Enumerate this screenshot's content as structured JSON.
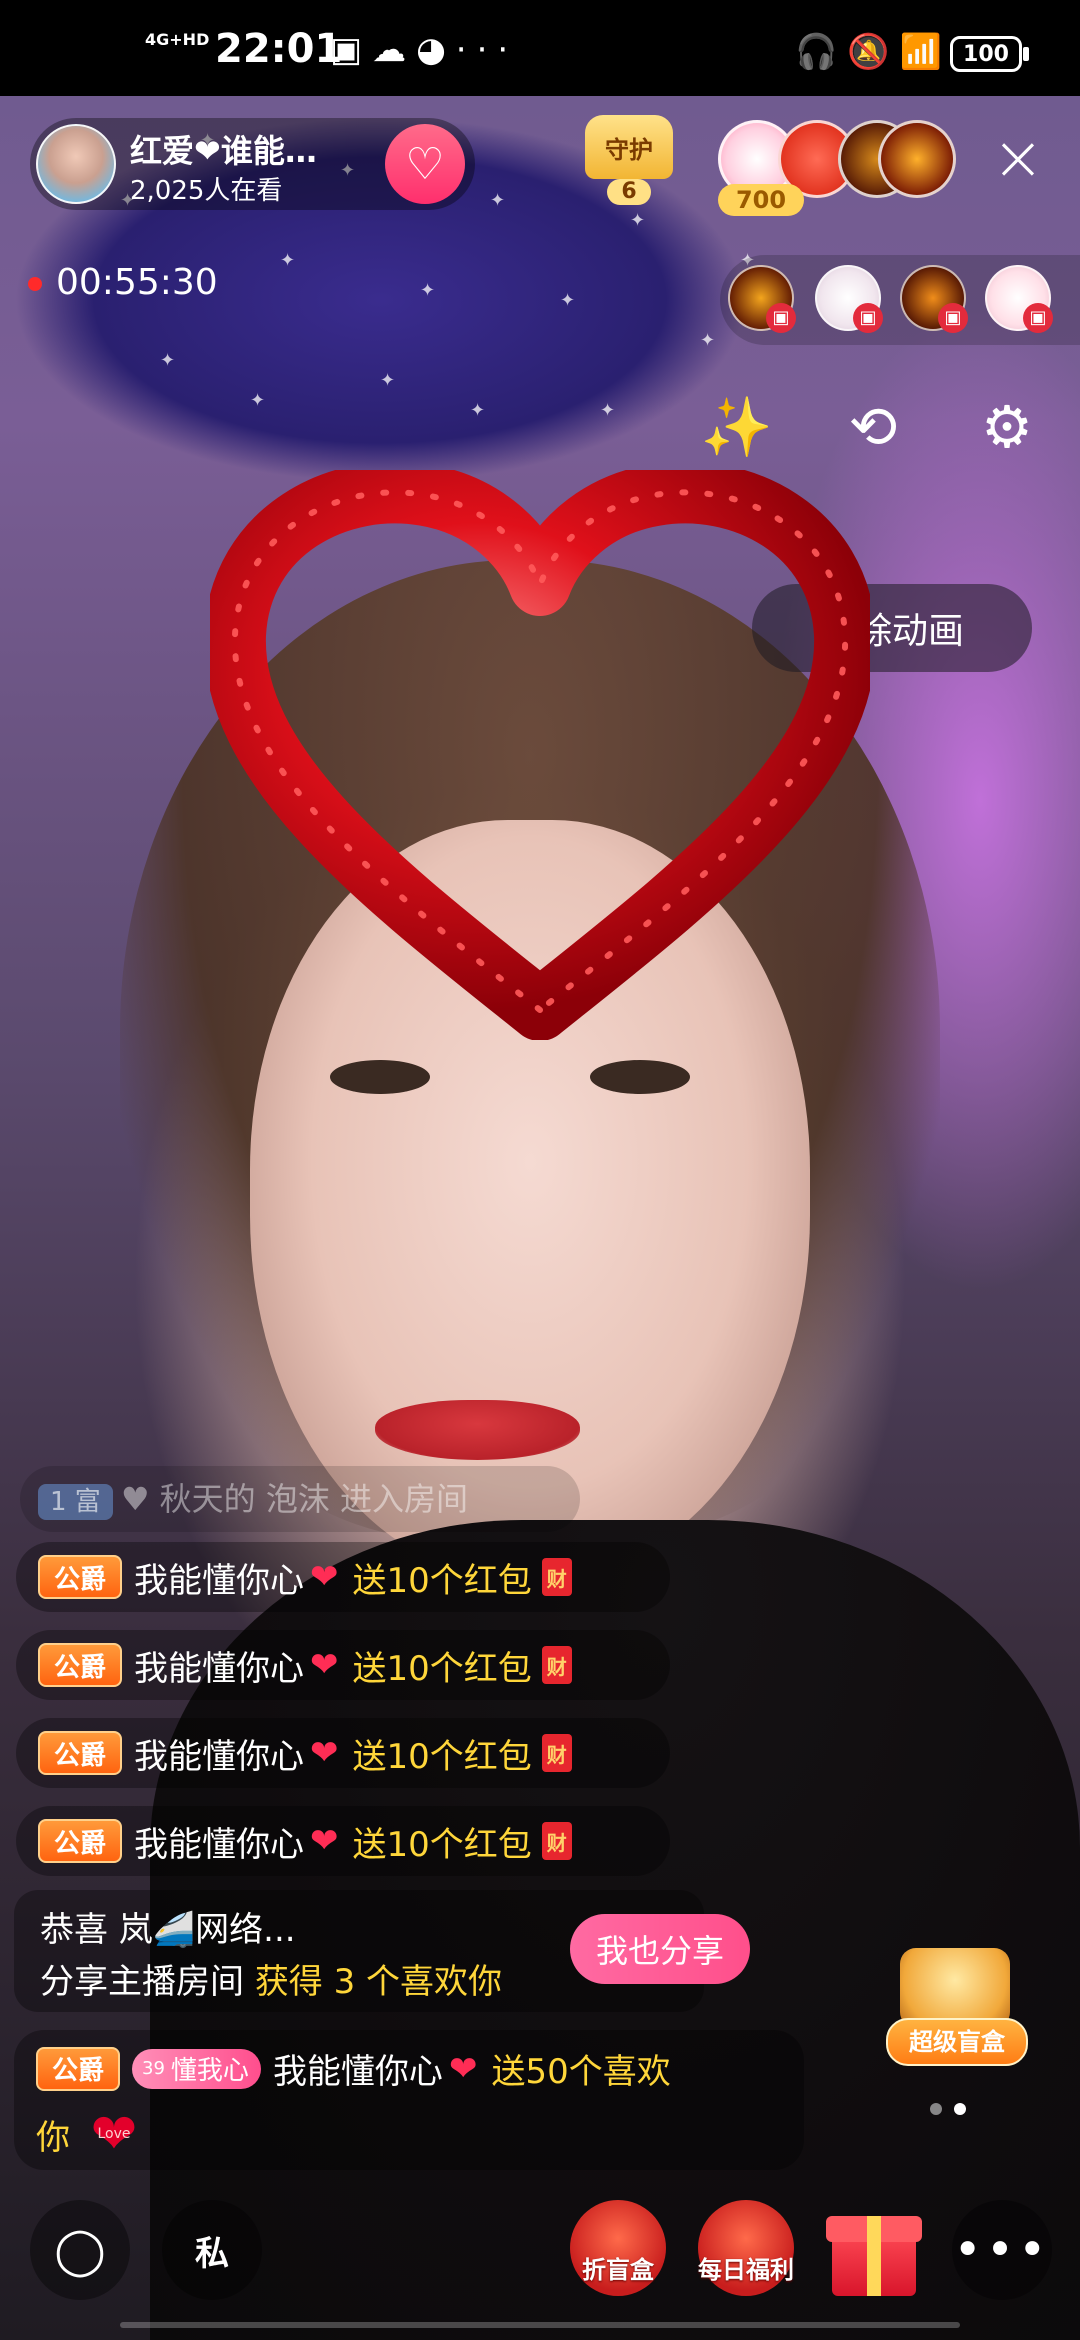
{
  "status_bar": {
    "network": "4G+HD",
    "time": "22:01",
    "battery": "100",
    "left_icons": [
      "sim-icon",
      "cloud-icon",
      "speed-icon",
      "more-dots"
    ],
    "right_icons": [
      "headphones-icon",
      "mute-icon",
      "wifi-icon"
    ]
  },
  "host": {
    "name": "红爱❤谁能…",
    "viewers": "2,025人在看",
    "follow_icon": "heart-plus-icon"
  },
  "guard": {
    "label": "守护",
    "count": "6"
  },
  "ranking": {
    "top_badge": "700"
  },
  "live_timer": "00:55:30",
  "tools": {
    "magic_icon": "magic-wand-icon",
    "camera_icon": "camera-switch-icon",
    "settings_icon": "gear-icon"
  },
  "clear_animation_button": "清除动画",
  "chat": {
    "ghost_message": {
      "level": "1 富",
      "text": "♥ 秋天的 泡沫 进入房间"
    },
    "duke_label": "公爵",
    "messages": [
      {
        "name": "我能懂你心",
        "gift": "送10个红包",
        "packet": "财"
      },
      {
        "name": "我能懂你心",
        "gift": "送10个红包",
        "packet": "财"
      },
      {
        "name": "我能懂你心",
        "gift": "送10个红包",
        "packet": "财"
      },
      {
        "name": "我能懂你心",
        "gift": "送10个红包",
        "packet": "财"
      }
    ],
    "share": {
      "line1": "恭喜 岚🚄网络...",
      "line2_prefix": "分享主播房间",
      "line2_highlight": "获得 3 个喜欢你",
      "button": "我也分享"
    },
    "last": {
      "fan_badge_level": "39",
      "fan_badge_name": "懂我心",
      "name": "我能懂你心",
      "gift_line1": "送50个喜欢",
      "gift_line2": "你",
      "heart_text": "Love"
    }
  },
  "blind_box": {
    "label": "超级盲盒"
  },
  "bottom_bar": {
    "chat_icon": "chat-bubble-icon",
    "private_label": "私",
    "discount_box_label": "折盲盒",
    "daily_label": "每日福利",
    "gift_icon": "gift-box-icon",
    "more_icon": "more-icon",
    "more_text": "•••"
  },
  "colors": {
    "accent_pink": "#ff4f8b",
    "gift_yellow": "#ffd63a",
    "duke_orange": "#ff6410",
    "heart_red": "#e3002b"
  }
}
